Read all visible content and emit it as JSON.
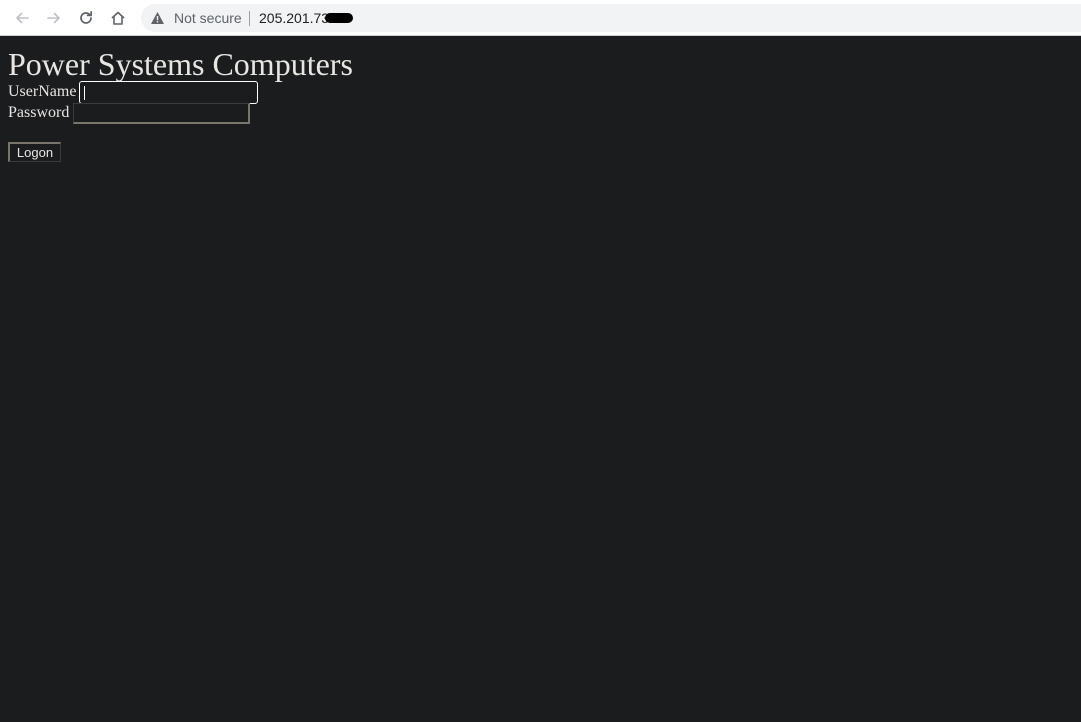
{
  "browser": {
    "security_label": "Not secure",
    "url": "205.201.73",
    "icons": [
      "back-arrow-icon",
      "forward-arrow-icon",
      "reload-icon",
      "home-icon",
      "warning-icon"
    ]
  },
  "page": {
    "title": "Power Systems Computers",
    "form": {
      "username_label": "UserName",
      "username_value": "",
      "password_label": "Password",
      "password_value": "",
      "submit_label": "Logon"
    }
  },
  "colors": {
    "page_background": "#1b1c1e",
    "text": "#e8e6e3",
    "toolbar_background": "#ffffff",
    "omnibox_background": "#f1f3f4"
  }
}
